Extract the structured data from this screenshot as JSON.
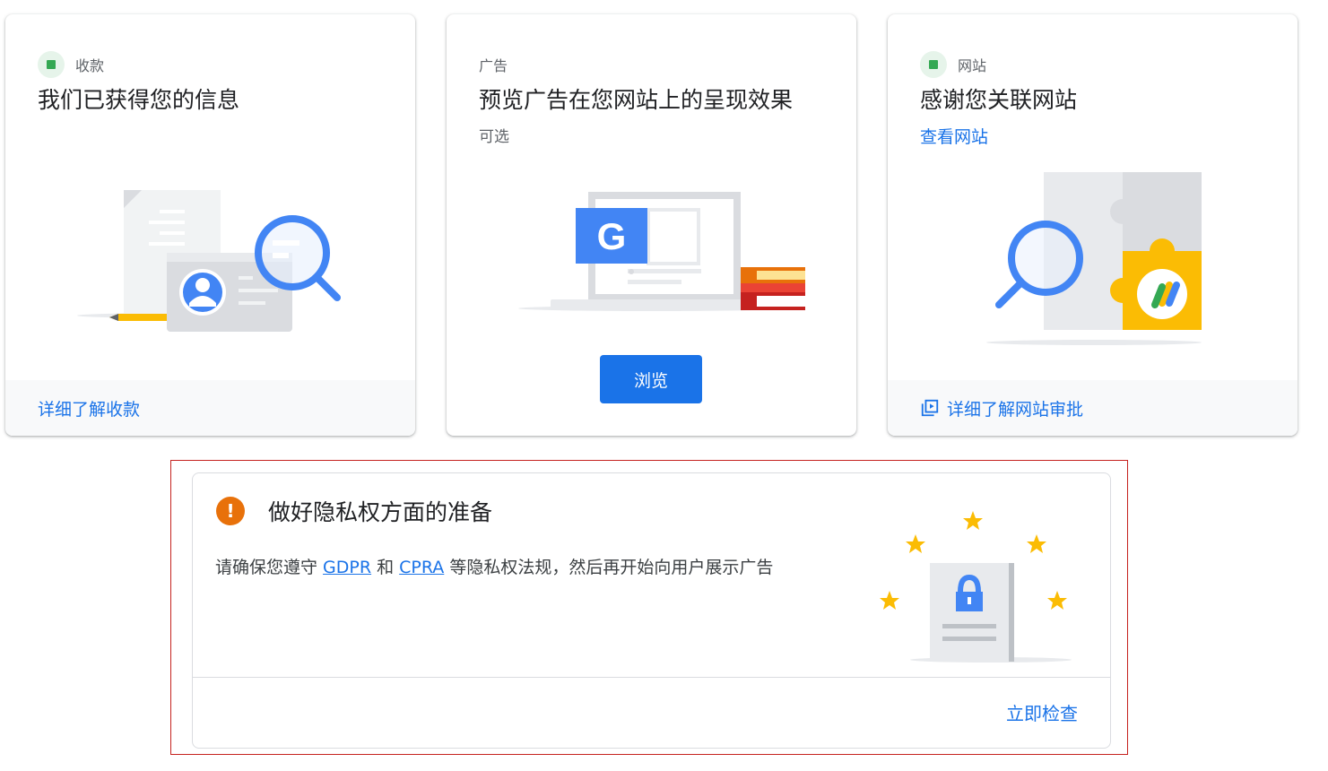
{
  "cards": [
    {
      "eyebrow": "收款",
      "title": "我们已获得您的信息",
      "footer_link": "详细了解收款",
      "icon": "check-badge-icon"
    },
    {
      "eyebrow": "广告",
      "title": "预览广告在您网站上的呈现效果",
      "subtitle": "可选",
      "button_label": "浏览"
    },
    {
      "eyebrow": "网站",
      "title": "感谢您关联网站",
      "link": "查看网站",
      "footer_link": "详细了解网站审批",
      "footer_icon": "external-link-icon",
      "icon": "check-badge-icon"
    }
  ],
  "privacy": {
    "title": "做好隐私权方面的准备",
    "text_before": "请确保您遵守 ",
    "gdpr": "GDPR",
    "text_and": " 和 ",
    "cpra": "CPRA",
    "text_after": " 等隐私权法规，然后再开始向用户展示广告",
    "action": "立即检查",
    "icon": "warning-icon"
  },
  "illustration_text": {
    "google_letter": "G"
  },
  "colors": {
    "primary": "#1a73e8",
    "success": "#34a853",
    "warning": "#e8710a",
    "star": "#fbbc04",
    "outline": "#c5221f"
  }
}
